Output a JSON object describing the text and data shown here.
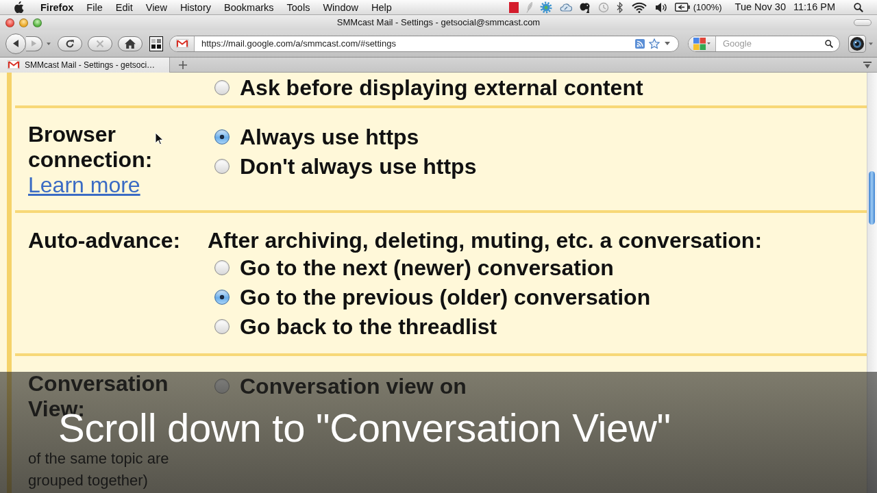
{
  "menu_bar": {
    "app": "Firefox",
    "menus": [
      "File",
      "Edit",
      "View",
      "History",
      "Bookmarks",
      "Tools",
      "Window",
      "Help"
    ],
    "battery": "(100%)",
    "date": "Tue Nov 30",
    "time": "11:16 PM"
  },
  "window": {
    "title": "SMMcast Mail - Settings - getsocial@smmcast.com"
  },
  "toolbar": {
    "buttons": [
      {
        "kind": "back",
        "disabled": false
      },
      {
        "kind": "forward",
        "disabled": true
      },
      {
        "kind": "reload",
        "disabled": false
      },
      {
        "kind": "stop",
        "disabled": true
      },
      {
        "kind": "home",
        "disabled": false
      }
    ],
    "url": "https://mail.google.com/a/smmcast.com/#settings",
    "search": {
      "placeholder": "Google"
    }
  },
  "tabs": [
    {
      "label": "SMMcast Mail - Settings - getsoci…",
      "selected": true
    }
  ],
  "settings": [
    {
      "options": [
        {
          "label": "Ask before displaying external content",
          "selected": false
        }
      ]
    },
    {
      "label": "Browser connection:",
      "link": "Learn more",
      "options": [
        {
          "label": "Always use https",
          "selected": true
        },
        {
          "label": "Don't always use https",
          "selected": false
        }
      ]
    },
    {
      "label": "Auto-advance:",
      "intro": "After archiving, deleting, muting, etc. a conversation:",
      "options": [
        {
          "label": "Go to the next (newer) conversation",
          "selected": false
        },
        {
          "label": "Go to the previous (older) conversation",
          "selected": true
        },
        {
          "label": "Go back to the threadlist",
          "selected": false
        }
      ]
    },
    {
      "label": "Conversation View:",
      "hint": "of the same topic are grouped together)",
      "options": [
        {
          "label": "Conversation view on",
          "selected": false
        }
      ]
    }
  ],
  "caption": "Scroll down to \"Conversation View\""
}
